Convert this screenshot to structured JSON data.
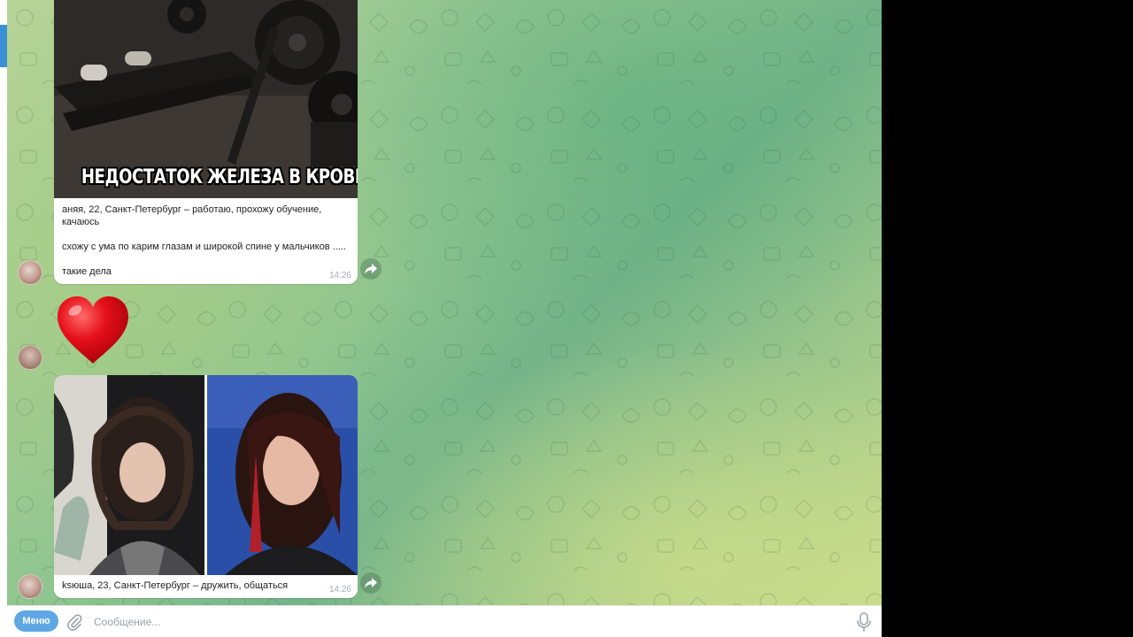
{
  "messages": [
    {
      "type": "photo_with_caption",
      "image_overlay_text": "НЕДОСТАТОК ЖЕЛЕЗА В КРОВИ",
      "caption_lines": [
        "аняя, 22, Санкт-Петербург – работаю, прохожу обучение, качаюсь",
        "схожу с ума по карим глазам и широкой спине у мальчиков .....",
        "такие дела"
      ],
      "time": "14:26"
    },
    {
      "type": "emoji",
      "emoji": "heart"
    },
    {
      "type": "album_with_caption",
      "caption": "ksюша, 23, Санкт-Петербург – дружить, общаться",
      "time": "14:26"
    }
  ],
  "composer": {
    "menu_label": "Меню",
    "placeholder": "Сообщение..."
  },
  "colors": {
    "accent": "#5fa7e3",
    "chat_bg_green": "#8dc48f",
    "bubble": "#ffffff"
  },
  "icons": [
    "share-icon",
    "attach-icon",
    "microphone-icon"
  ]
}
